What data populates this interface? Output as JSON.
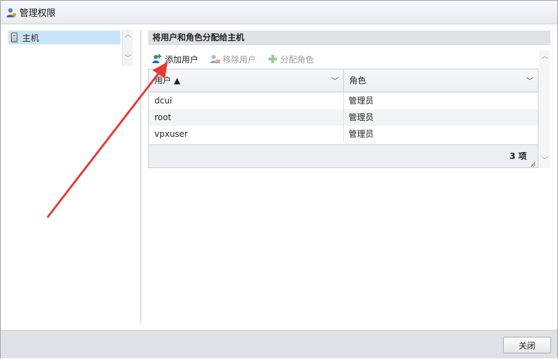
{
  "window": {
    "title": "管理权限",
    "icon": "user-permissions-icon"
  },
  "sidebar": {
    "items": [
      {
        "label": "主机",
        "icon": "host-icon",
        "selected": true
      }
    ]
  },
  "section": {
    "title": "将用户和角色分配给主机"
  },
  "toolbar": {
    "add_user": "添加用户",
    "remove_user": "移除用户",
    "assign_role": "分配角色"
  },
  "grid": {
    "columns": [
      {
        "label": "用户 ▲"
      },
      {
        "label": "角色"
      }
    ],
    "rows": [
      {
        "user": "dcui",
        "role": "管理员"
      },
      {
        "user": "root",
        "role": "管理员"
      },
      {
        "user": "vpxuser",
        "role": "管理员"
      }
    ],
    "count_label": "3 项"
  },
  "footer": {
    "close_label": "关闭"
  },
  "colors": {
    "selection": "#c8e3f8",
    "header_bg": "#dfe1e5",
    "annotation_arrow": "#e53935"
  }
}
